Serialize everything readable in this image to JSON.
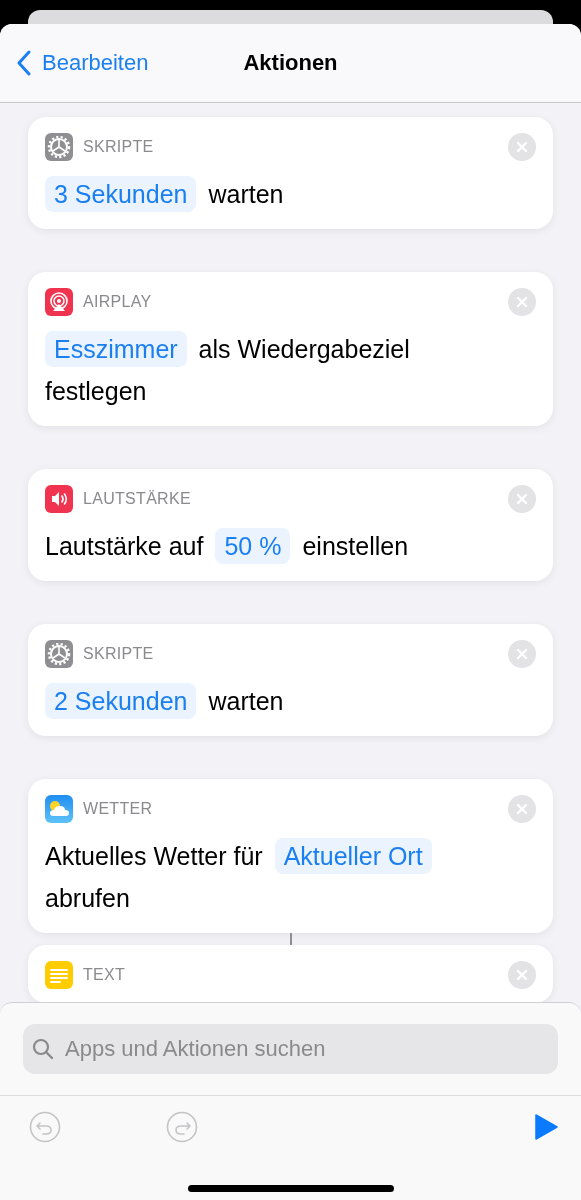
{
  "nav": {
    "back": "Bearbeiten",
    "title": "Aktionen"
  },
  "actions": [
    {
      "kind": "scripting",
      "category": "SKRIPTE",
      "connected": false,
      "parts": [
        {
          "kind": "token",
          "text": "3 Sekunden"
        },
        {
          "kind": "text",
          "text": "warten"
        }
      ]
    },
    {
      "kind": "airplay",
      "category": "AIRPLAY",
      "connected": false,
      "parts": [
        {
          "kind": "token",
          "text": "Esszimmer"
        },
        {
          "kind": "text",
          "text": "als Wiedergabeziel"
        },
        {
          "kind": "text",
          "text": "festlegen"
        }
      ]
    },
    {
      "kind": "volume",
      "category": "LAUTSTÄRKE",
      "connected": false,
      "parts": [
        {
          "kind": "text",
          "text": "Lautstärke auf"
        },
        {
          "kind": "token",
          "text": "50 %"
        },
        {
          "kind": "text",
          "text": "einstellen"
        }
      ]
    },
    {
      "kind": "scripting",
      "category": "SKRIPTE",
      "connected": false,
      "parts": [
        {
          "kind": "token",
          "text": "2 Sekunden"
        },
        {
          "kind": "text",
          "text": "warten"
        }
      ]
    },
    {
      "kind": "weather",
      "category": "WETTER",
      "connected": false,
      "parts": [
        {
          "kind": "text",
          "text": "Aktuelles Wetter für"
        },
        {
          "kind": "token",
          "text": "Aktueller Ort"
        },
        {
          "kind": "text",
          "text": "abrufen"
        }
      ]
    },
    {
      "kind": "text",
      "category": "TEXT",
      "connected": true
    }
  ],
  "search": {
    "placeholder": "Apps und Aktionen suchen"
  },
  "toolbar": {
    "undo_disabled": true,
    "redo_disabled": true
  }
}
